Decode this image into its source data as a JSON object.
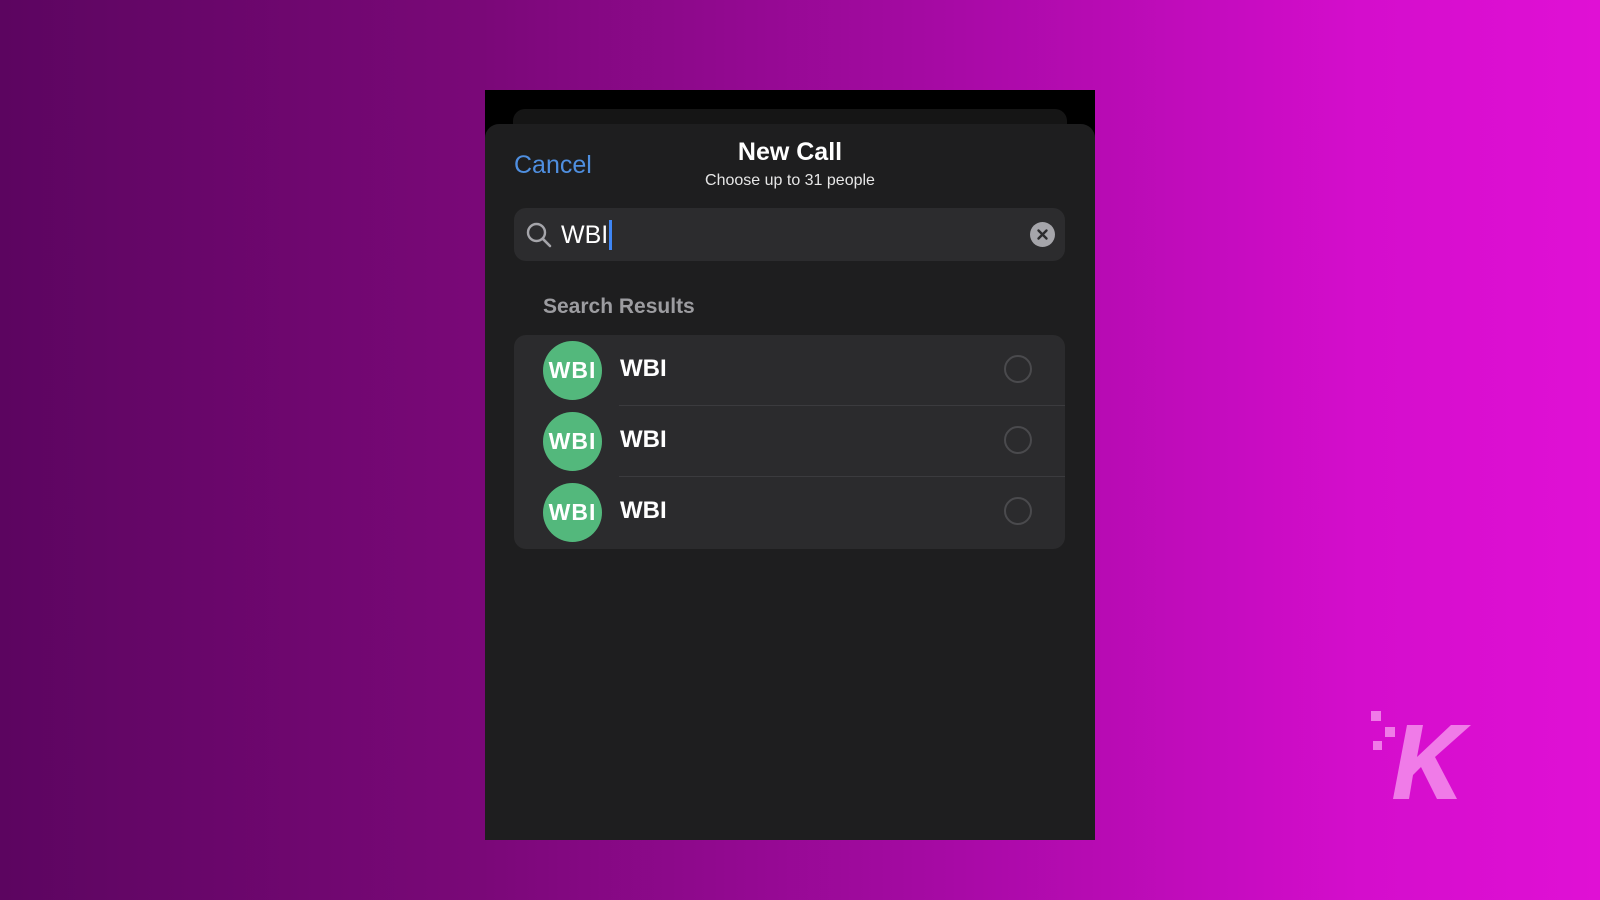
{
  "header": {
    "cancel_label": "Cancel",
    "title": "New Call",
    "subtitle": "Choose up to 31 people"
  },
  "search": {
    "value": "WBI",
    "icon": "search-icon",
    "clear_icon": "clear-icon"
  },
  "results": {
    "section_title": "Search Results",
    "items": [
      {
        "name": "WBI",
        "avatar_text": "WBI",
        "selected": false
      },
      {
        "name": "WBI",
        "avatar_text": "WBI",
        "selected": false
      },
      {
        "name": "WBI",
        "avatar_text": "WBI",
        "selected": false
      }
    ]
  },
  "colors": {
    "accent": "#4f8fe0",
    "avatar": "#53b87c",
    "sheet": "#1e1e1f",
    "background_start": "#5c0560",
    "background_end": "#e010d5"
  },
  "watermark": {
    "icon": "k-logo-icon"
  }
}
